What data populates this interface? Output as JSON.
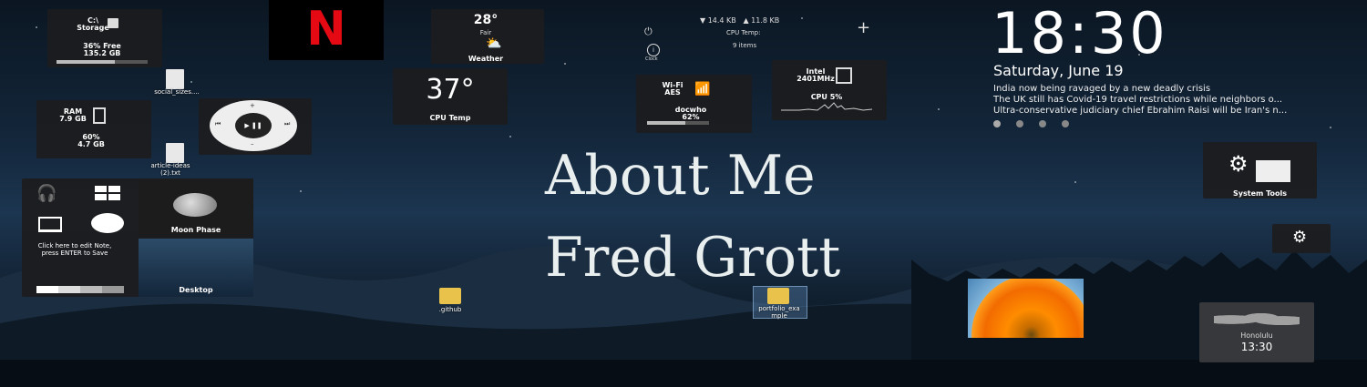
{
  "storage": {
    "drive": "C:\\",
    "label": "Storage",
    "free_pct": "36% Free",
    "free_gb": "135.2 GB",
    "usage": 0.64
  },
  "netflix": {
    "letter": "N",
    "color": "#e50914"
  },
  "weather": {
    "temp": "28°",
    "condition": "Fair",
    "label": "Weather"
  },
  "network": {
    "down": "▼ 14.4 KB",
    "up": "▲ 11.8 KB",
    "cpu_temp_label": "CPU Temp:",
    "items": "9 items",
    "clock_label": "Clock"
  },
  "clock": {
    "time": "18:30",
    "date": "Saturday, June 19"
  },
  "news": [
    "India now being ravaged by a new deadly crisis",
    "The UK still has Covid-19 travel restrictions while neighbors o...",
    "Ultra-conservative judiciary chief Ebrahim Raisi will be Iran's n..."
  ],
  "ram": {
    "label": "RAM",
    "total": "7.9 GB",
    "pct": "60%",
    "used": "4.7 GB"
  },
  "cpu_temp": {
    "value": "37°",
    "label": "CPU Temp"
  },
  "wifi": {
    "label": "Wi-Fi",
    "ssid": "AES",
    "user": "docwho",
    "signal": "62%",
    "signal_level": 0.62
  },
  "cpu": {
    "model": "Intel",
    "speed": "2401MHz",
    "usage": "CPU 5%"
  },
  "system_tools": {
    "label": "System Tools"
  },
  "files": {
    "social": "social_sizes....",
    "article": "article-ideas (2).txt",
    "github": ".github",
    "portfolio": "portfolio_exa mple"
  },
  "note": {
    "text": "Click here to edit Note, press ENTER to Save"
  },
  "moon": {
    "label": "Moon Phase"
  },
  "desktop": {
    "label": "Desktop"
  },
  "heading": {
    "line1": "About Me",
    "line2": "Fred Grott"
  },
  "world_clock": {
    "city": "Honolulu",
    "time": "13:30"
  }
}
